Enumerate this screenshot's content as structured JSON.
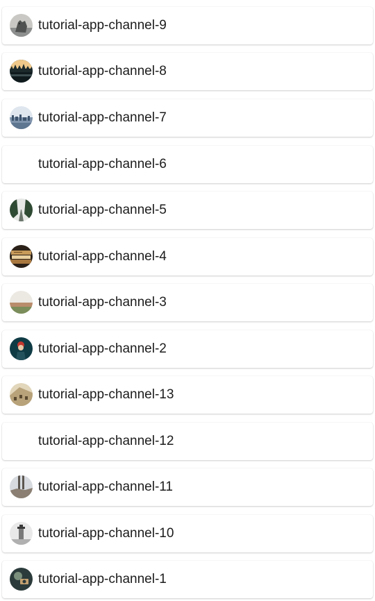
{
  "channels": [
    {
      "name": "tutorial-app-channel-9",
      "avatar": "wolf-photo-icon",
      "has_avatar": true,
      "colors": [
        "#8d8f8e",
        "#4f5250",
        "#c9c8c4"
      ]
    },
    {
      "name": "tutorial-app-channel-8",
      "avatar": "forest-lake-photo-icon",
      "has_avatar": true,
      "colors": [
        "#f0c98a",
        "#1c2a2c",
        "#0f1a1d"
      ]
    },
    {
      "name": "tutorial-app-channel-7",
      "avatar": "city-skyline-photo-icon",
      "has_avatar": true,
      "colors": [
        "#dfe6ee",
        "#7f94ac",
        "#3e536d"
      ]
    },
    {
      "name": "tutorial-app-channel-6",
      "avatar": "",
      "has_avatar": false,
      "colors": []
    },
    {
      "name": "tutorial-app-channel-5",
      "avatar": "tree-road-photo-icon",
      "has_avatar": true,
      "colors": [
        "#e6e8e6",
        "#2f4a33",
        "#6b756c"
      ]
    },
    {
      "name": "tutorial-app-channel-4",
      "avatar": "books-photo-icon",
      "has_avatar": true,
      "colors": [
        "#2b2118",
        "#c79a5a",
        "#e8cf9e"
      ]
    },
    {
      "name": "tutorial-app-channel-3",
      "avatar": "field-horizon-photo-icon",
      "has_avatar": true,
      "colors": [
        "#ece9e3",
        "#b98d6c",
        "#7b8d5a"
      ]
    },
    {
      "name": "tutorial-app-channel-2",
      "avatar": "person-red-hat-photo-icon",
      "has_avatar": true,
      "colors": [
        "#0f3b45",
        "#c2372e",
        "#e7c8a6"
      ]
    },
    {
      "name": "tutorial-app-channel-13",
      "avatar": "building-photo-icon",
      "has_avatar": true,
      "colors": [
        "#b7a27a",
        "#5b4a30",
        "#e2d6bb"
      ]
    },
    {
      "name": "tutorial-app-channel-12",
      "avatar": "",
      "has_avatar": false,
      "colors": []
    },
    {
      "name": "tutorial-app-channel-11",
      "avatar": "legs-rocks-photo-icon",
      "has_avatar": true,
      "colors": [
        "#d7dbe0",
        "#5c5650",
        "#8a7f72"
      ]
    },
    {
      "name": "tutorial-app-channel-10",
      "avatar": "lighthouse-photo-icon",
      "has_avatar": true,
      "colors": [
        "#e9e9e9",
        "#7a7a7a",
        "#3a3a3a"
      ]
    },
    {
      "name": "tutorial-app-channel-1",
      "avatar": "camera-person-photo-icon",
      "has_avatar": true,
      "colors": [
        "#2b3a3a",
        "#7a8f7c",
        "#c2a070"
      ]
    }
  ]
}
